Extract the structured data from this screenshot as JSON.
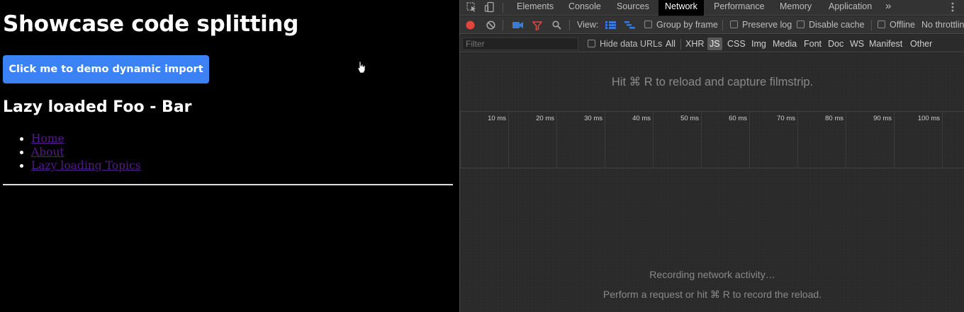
{
  "app": {
    "title": "Showcase code splitting",
    "button_label": "Click me to demo dynamic import",
    "subtitle": "Lazy loaded Foo - Bar",
    "nav_links": [
      "Home",
      "About",
      "Lazy loading Topics"
    ]
  },
  "devtools": {
    "tabs": [
      "Elements",
      "Console",
      "Sources",
      "Network",
      "Performance",
      "Memory",
      "Application"
    ],
    "active_tab": "Network",
    "more_tabs_glyph": "»",
    "toolbar": {
      "view_label": "View:",
      "group_by_frame": "Group by frame",
      "preserve_log": "Preserve log",
      "disable_cache": "Disable cache",
      "offline": "Offline",
      "throttling": "No throttling"
    },
    "filter": {
      "placeholder": "Filter",
      "hide_data_urls": "Hide data URLs",
      "types": [
        "All",
        "XHR",
        "JS",
        "CSS",
        "Img",
        "Media",
        "Font",
        "Doc",
        "WS",
        "Manifest",
        "Other"
      ],
      "active_type": "JS"
    },
    "filmstrip_hint": "Hit ⌘ R to reload and capture filmstrip.",
    "timeline_ticks": [
      "10 ms",
      "20 ms",
      "30 ms",
      "40 ms",
      "50 ms",
      "60 ms",
      "70 ms",
      "80 ms",
      "90 ms",
      "100 ms"
    ],
    "recording_text": "Recording network activity…",
    "perform_request_text": "Perform a request or hit ⌘ R to record the reload."
  },
  "colors": {
    "button_blue": "#3b82f6",
    "link_visited": "#551a8b",
    "record_red": "#e3453a",
    "filter_red": "#e3453a",
    "active_blue": "#3a7bd5"
  },
  "icons": [
    "inspect-element-icon",
    "device-toolbar-icon",
    "record-icon",
    "clear-icon",
    "camera-icon",
    "filter-icon",
    "search-icon",
    "large-rows-icon",
    "waterfall-icon",
    "kebab-menu-icon",
    "hand-cursor-icon"
  ]
}
